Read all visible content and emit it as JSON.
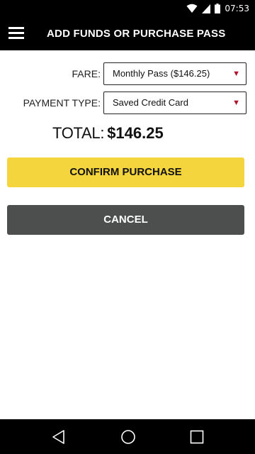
{
  "status_bar": {
    "time": "07:53",
    "icons": [
      "wifi-icon",
      "signal-icon",
      "battery-icon"
    ]
  },
  "app_bar": {
    "menu_icon": "hamburger-menu-icon",
    "title": "ADD FUNDS OR PURCHASE PASS"
  },
  "form": {
    "fare": {
      "label": "FARE:",
      "value": "Monthly Pass ($146.25)",
      "arrow": "▼"
    },
    "payment_type": {
      "label": "PAYMENT TYPE:",
      "value": "Saved Credit Card",
      "arrow": "▼"
    },
    "total": {
      "label": "TOTAL:",
      "amount": "$146.25"
    }
  },
  "buttons": {
    "confirm": "CONFIRM PURCHASE",
    "cancel": "CANCEL"
  },
  "colors": {
    "confirm_bg": "#f5d53d",
    "cancel_bg": "#4d4f4f",
    "arrow": "#b3122e",
    "bar": "#000000"
  },
  "nav_bar": {
    "icons": [
      "back-icon",
      "home-icon",
      "recents-icon"
    ]
  }
}
